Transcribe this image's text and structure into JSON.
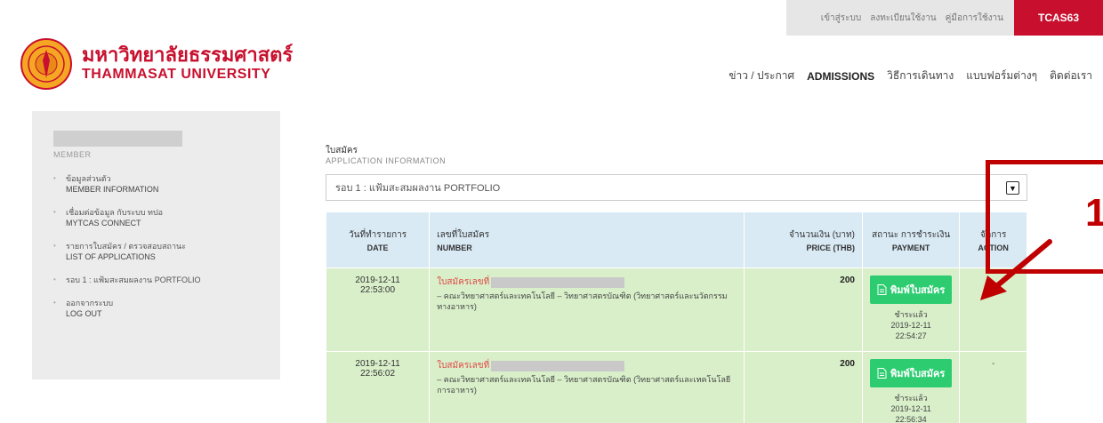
{
  "topbar": {
    "links": [
      "เข้าสู่ระบบ",
      "ลงทะเบียนใช้งาน",
      "คู่มือการใช้งาน"
    ],
    "tcas": "TCAS63"
  },
  "logo": {
    "th": "มหาวิทยาลัยธรรมศาสตร์",
    "en": "THAMMASAT UNIVERSITY"
  },
  "nav": {
    "news": "ข่าว / ประกาศ",
    "admissions": "ADMISSIONS",
    "travel": "วิธีการเดินทาง",
    "forms": "แบบฟอร์มต่างๆ",
    "contact": "ติดต่อเรา"
  },
  "sidebar": {
    "member_label": "MEMBER",
    "items": [
      {
        "th": "ข้อมูลส่วนตัว",
        "en": "MEMBER INFORMATION"
      },
      {
        "th": "เชื่อมต่อข้อมูล กับระบบ ทปอ",
        "en": "MYTCAS CONNECT"
      },
      {
        "th": "รายการใบสมัคร / ตรวจสอบสถานะ",
        "en": "LIST OF APPLICATIONS"
      },
      {
        "th": "รอบ 1 : แฟ้มสะสมผลงาน PORTFOLIO",
        "en": ""
      },
      {
        "th": "ออกจากระบบ",
        "en": "LOG OUT"
      }
    ]
  },
  "section": {
    "title": "ใบสมัคร",
    "subtitle": "APPLICATION INFORMATION",
    "round_selected": "รอบ 1 : แฟ้มสะสมผลงาน PORTFOLIO"
  },
  "table": {
    "headers": {
      "date_th": "วันที่ทำรายการ",
      "date_en": "DATE",
      "number_th": "เลขที่ใบสมัคร",
      "number_en": "NUMBER",
      "price_th": "จำนวนเงิน (บาท)",
      "price_en": "PRICE (THB)",
      "payment_th": "สถานะ การชำระเงิน",
      "payment_en": "PAYMENT",
      "action_th": "จัดการ",
      "action_en": "ACTION"
    },
    "rows": [
      {
        "date": "2019-12-11",
        "time": "22:53:00",
        "app_label": "ใบสมัครเลขที่",
        "faculty": "– คณะวิทยาศาสตร์และเทคโนโลยี – วิทยาศาสตรบัณฑิต (วิทยาศาสตร์และนวัตกรรมทางอาหาร)",
        "price": "200",
        "print_label": "พิมพ์ใบสมัคร",
        "paid_label": "ชำระแล้ว",
        "paid_date": "2019-12-11",
        "paid_time": "22:54:27",
        "action": ""
      },
      {
        "date": "2019-12-11",
        "time": "22:56:02",
        "app_label": "ใบสมัครเลขที่",
        "faculty": "– คณะวิทยาศาสตร์และเทคโนโลยี – วิทยาศาสตรบัณฑิต (วิทยาศาสตร์และเทคโนโลยีการอาหาร)",
        "price": "200",
        "print_label": "พิมพ์ใบสมัคร",
        "paid_label": "ชำระแล้ว",
        "paid_date": "2019-12-11",
        "paid_time": "22:56:34",
        "action": "-"
      }
    ]
  },
  "annotation": {
    "number": "1",
    "color": "#c00000"
  },
  "colors": {
    "brand_red": "#c8102e",
    "header_blue": "#d9eaf5",
    "row_green": "#d8efc9",
    "button_green": "#2ecc71"
  }
}
